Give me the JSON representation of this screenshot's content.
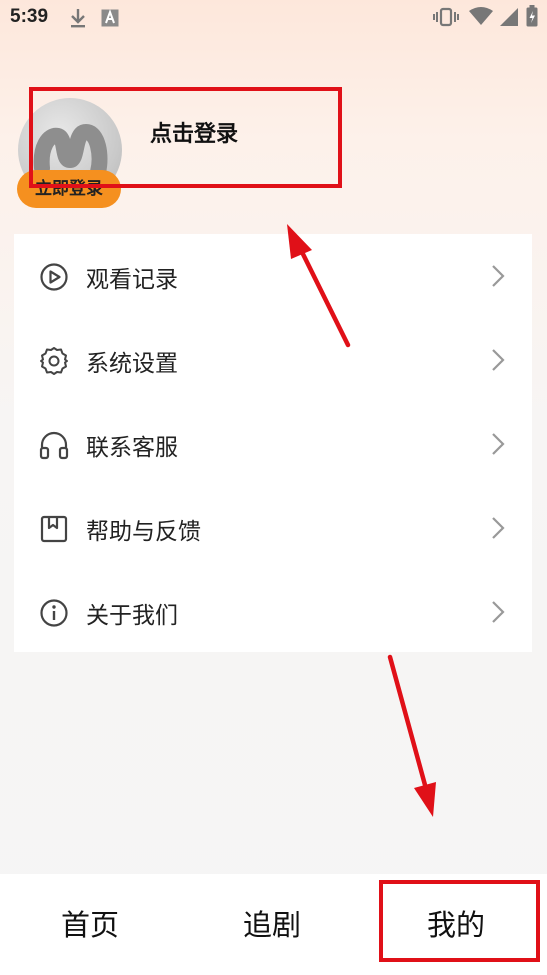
{
  "status_bar": {
    "time": "5:39",
    "left_icons": [
      "download-icon",
      "a-badge-icon"
    ],
    "right_icons": [
      "vibrate-icon",
      "wifi-icon",
      "signal-icon",
      "battery-icon"
    ]
  },
  "profile": {
    "avatar_icon": "app-logo-icon",
    "login_badge": "立即登录",
    "login_title": "点击登录"
  },
  "menu": {
    "items": [
      {
        "label": "观看记录",
        "icon": "play-circle-icon"
      },
      {
        "label": "系统设置",
        "icon": "gear-icon"
      },
      {
        "label": "联系客服",
        "icon": "headphones-icon"
      },
      {
        "label": "帮助与反馈",
        "icon": "bookmark-icon"
      },
      {
        "label": "关于我们",
        "icon": "info-icon"
      }
    ]
  },
  "bottom_nav": {
    "tabs": [
      {
        "label": "首页"
      },
      {
        "label": "追剧"
      },
      {
        "label": "我的"
      }
    ]
  },
  "colors": {
    "annotation_red": "#e01018",
    "login_badge_orange": "#f5901f"
  }
}
